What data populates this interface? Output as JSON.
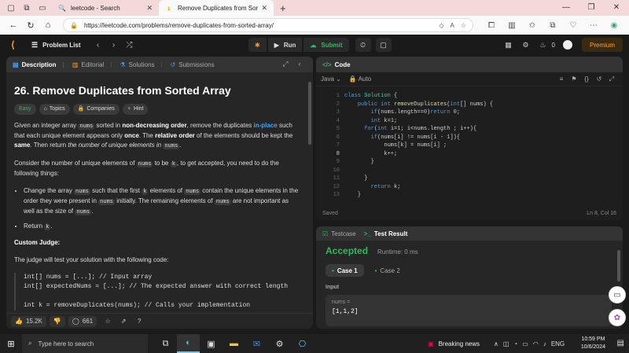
{
  "browser": {
    "tabs": [
      {
        "title": "leetcode - Search",
        "active": false
      },
      {
        "title": "Remove Duplicates from Sorted A",
        "active": true
      }
    ],
    "url": "https://leetcode.com/problems/remove-duplicates-from-sorted-array/"
  },
  "nav": {
    "problem_list": "Problem List",
    "run": "Run",
    "submit": "Submit",
    "streak": "0",
    "premium": "Premium"
  },
  "left": {
    "tabs": [
      "Description",
      "Editorial",
      "Solutions",
      "Submissions"
    ],
    "title": "26. Remove Duplicates from Sorted Array",
    "tags": [
      "Easy",
      "Topics",
      "Companies",
      "Hint"
    ],
    "p1": {
      "a": "Given an integer array ",
      "nums": "nums",
      "b": " sorted in ",
      "c": "non-decreasing order",
      "d": ", remove the duplicates ",
      "e": "in-place",
      "f": " such that each unique element appears only ",
      "g": "once",
      "h": ". The ",
      "i": "relative order",
      "j": " of the elements should be kept the ",
      "k": "same",
      "l": ". Then return ",
      "m": "the number of unique elements in",
      "n": "."
    },
    "p2": {
      "a": "Consider the number of unique elements of ",
      "b": " to be ",
      "k": "k",
      "c": ", to get accepted, you need to do the following things:"
    },
    "li1": {
      "a": "Change the array ",
      "b": " such that the first ",
      "c": " elements of ",
      "d": " contain the unique elements in the order they were present in ",
      "e": " initially. The remaining elements of ",
      "f": " are not important as well as the size of ",
      "g": "."
    },
    "li2": {
      "a": "Return ",
      "b": "."
    },
    "judge_title": "Custom Judge:",
    "judge_text": "The judge will test your solution with the following code:",
    "code": [
      "int[] nums = [...]; // Input array",
      "int[] expectedNums = [...]; // The expected answer with correct length",
      "",
      "int k = removeDuplicates(nums); // Calls your implementation"
    ],
    "likes": "15.2K",
    "comments": "661"
  },
  "editor": {
    "header": "Code",
    "language": "Java",
    "mode": "Auto",
    "line_numbers": [
      "1",
      "2",
      "3",
      "4",
      "5",
      "6",
      "7",
      "8",
      "9",
      "10",
      "11",
      "12",
      "13"
    ],
    "status_left": "Saved",
    "status_right": "Ln 8, Col 16"
  },
  "result": {
    "tabs": [
      "Testcase",
      "Test Result"
    ],
    "status": "Accepted",
    "runtime": "Runtime: 0 ms",
    "cases": [
      "Case 1",
      "Case 2"
    ],
    "input_label": "Input",
    "var": "nums =",
    "value": "[1,1,2]"
  },
  "taskbar": {
    "search_placeholder": "Type here to search",
    "news": "Breaking news",
    "lang": "ENG",
    "time": "10:59 PM",
    "date": "10/6/2024"
  }
}
